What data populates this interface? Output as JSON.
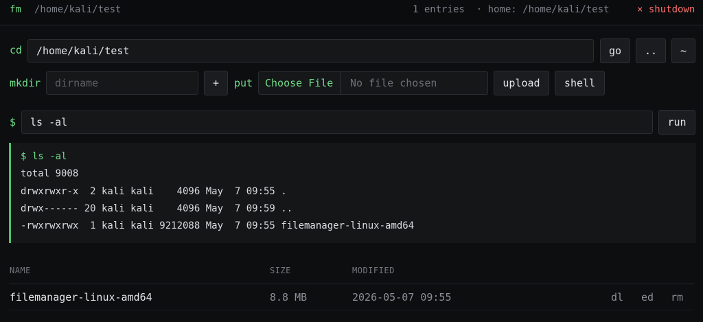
{
  "topbar": {
    "brand": "fm",
    "path": "/home/kali/test",
    "entries": "1 entries",
    "home": "· home: /home/kali/test",
    "shutdown": "× shutdown"
  },
  "cd": {
    "label": "cd",
    "value": "/home/kali/test",
    "go": "go",
    "up": "..",
    "home": "~"
  },
  "mkdir": {
    "label": "mkdir",
    "placeholder": "dirname",
    "add": "+"
  },
  "put": {
    "label": "put",
    "choose": "Choose File",
    "nofile": "No file chosen",
    "upload": "upload",
    "shell": "shell"
  },
  "command": {
    "prompt": "$",
    "value": "ls -al",
    "run": "run"
  },
  "output": {
    "cmd": "$ ls -al",
    "lines": [
      "total 9008",
      "drwxrwxr-x  2 kali kali    4096 May  7 09:55 .",
      "drwx------ 20 kali kali    4096 May  7 09:59 ..",
      "-rwxrwxrwx  1 kali kali 9212088 May  7 09:55 filemanager-linux-amd64"
    ]
  },
  "table": {
    "headers": {
      "name": "NAME",
      "size": "SIZE",
      "modified": "MODIFIED"
    },
    "rows": [
      {
        "name": "filemanager-linux-amd64",
        "size": "8.8 MB",
        "modified": "2026-05-07 09:55",
        "actions": {
          "dl": "dl",
          "ed": "ed",
          "rm": "rm"
        }
      }
    ]
  },
  "colors": {
    "accent": "#6fdc87",
    "danger": "#ff6e6e",
    "background": "#0d0e10"
  }
}
